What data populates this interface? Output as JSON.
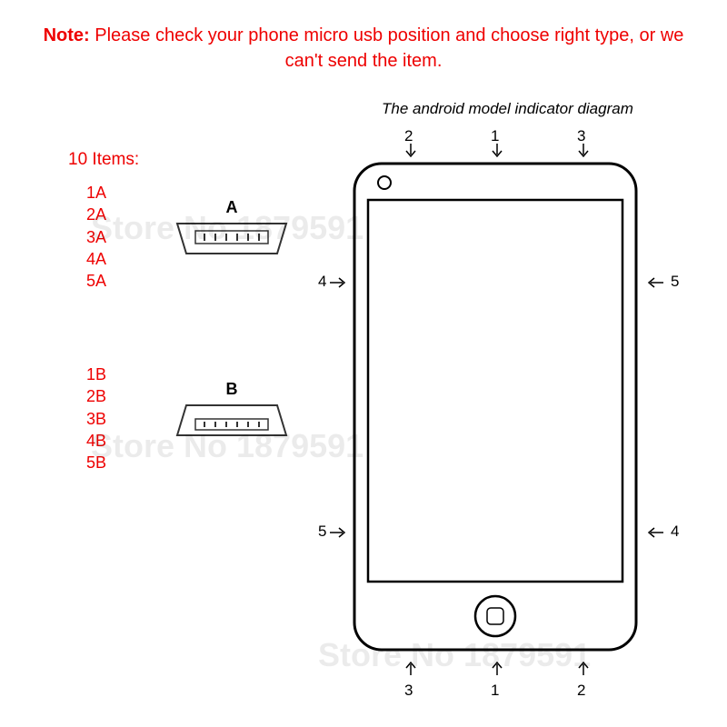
{
  "note": {
    "label": "Note:",
    "text": " Please check your phone micro usb position and choose right type, or we can't send the item."
  },
  "diagram_title": "The android model indicator diagram",
  "items_title": "10 Items:",
  "connector_a": {
    "label": "A",
    "items": [
      "1A",
      "2A",
      "3A",
      "4A",
      "5A"
    ]
  },
  "connector_b": {
    "label": "B",
    "items": [
      "1B",
      "2B",
      "3B",
      "4B",
      "5B"
    ]
  },
  "indicators": {
    "top": [
      "2",
      "1",
      "3"
    ],
    "bottom": [
      "3",
      "1",
      "2"
    ],
    "left_upper": "4",
    "left_lower": "5",
    "right_upper": "5",
    "right_lower": "4"
  },
  "watermark": "Store No 1879591"
}
